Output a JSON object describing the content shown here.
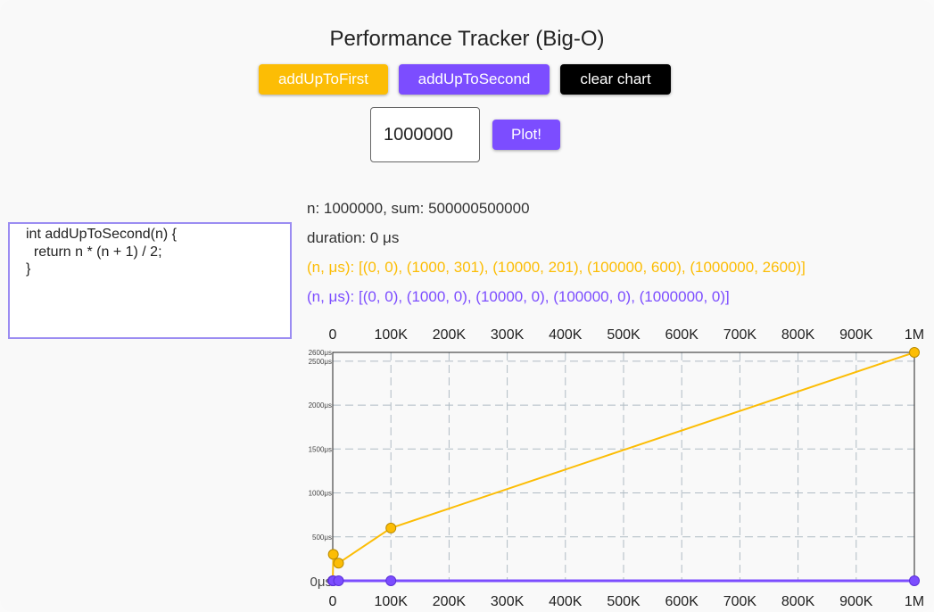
{
  "header": {
    "title": "Performance Tracker (Big-O)"
  },
  "toolbar": {
    "first_label": "addUpToFirst",
    "second_label": "addUpToSecond",
    "clear_label": "clear chart",
    "plot_label": "Plot!",
    "n_value": "1000000"
  },
  "code": {
    "text": "int addUpToSecond(n) {\n  return n * (n + 1) / 2;\n}"
  },
  "info": {
    "result": "n: 1000000, sum: 500000500000",
    "duration": "duration: 0 μs",
    "first_points": "(n, μs): [(0, 0), (1000, 301), (10000, 201), (100000, 600), (1000000, 2600)]",
    "second_points": "(n, μs): [(0, 0), (1000, 0), (10000, 0), (100000, 0), (1000000, 0)]"
  },
  "colors": {
    "first": "#fcbd05",
    "second": "#7c4dff",
    "clear": "#000000",
    "accent_border": "#9b8cf2"
  },
  "chart_data": {
    "type": "line",
    "xlim": [
      0,
      1000000
    ],
    "ylim": [
      0,
      2600
    ],
    "x_ticks": [
      0,
      100000,
      200000,
      300000,
      400000,
      500000,
      600000,
      700000,
      800000,
      900000,
      1000000
    ],
    "x_tick_labels": [
      "0",
      "100K",
      "200K",
      "300K",
      "400K",
      "500K",
      "600K",
      "700K",
      "800K",
      "900K",
      "1M"
    ],
    "y_ticks": [
      0,
      500,
      1000,
      1500,
      2000,
      2500,
      2600
    ],
    "y_tick_labels": [
      "0μs",
      "500μs",
      "1000μs",
      "1500μs",
      "2000μs",
      "2500μs",
      "2600μs"
    ],
    "grid": true,
    "series": [
      {
        "color": "#fcbd05",
        "x": [
          0,
          1000,
          10000,
          100000,
          1000000
        ],
        "y": [
          0,
          301,
          201,
          600,
          2600
        ]
      },
      {
        "color": "#7c4dff",
        "x": [
          0,
          1000,
          10000,
          100000,
          1000000
        ],
        "y": [
          0,
          0,
          0,
          0,
          0
        ]
      }
    ]
  }
}
